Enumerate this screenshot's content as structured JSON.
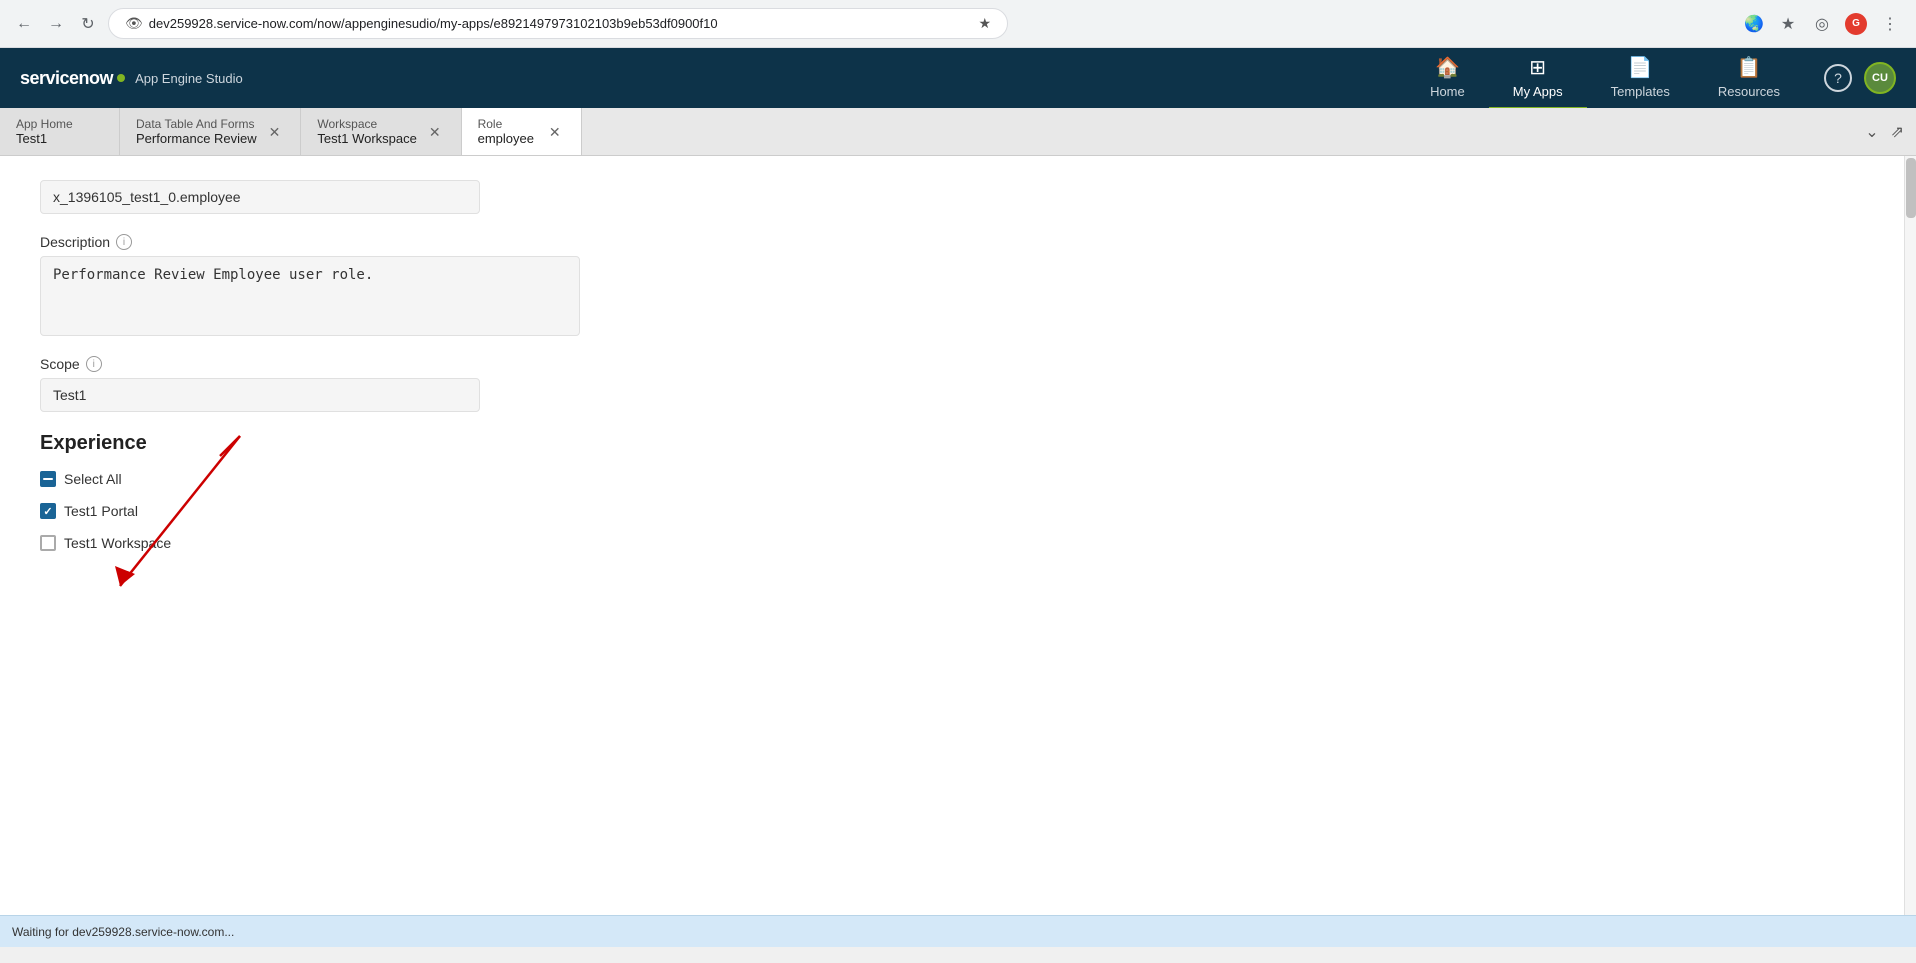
{
  "browser": {
    "url": "dev259928.service-now.com/now/appenginesudio/my-apps/e8921497973102103b9eb53df0900f10",
    "back_tooltip": "Back",
    "forward_tooltip": "Forward",
    "reload_tooltip": "Reload"
  },
  "header": {
    "logo": "servicenow",
    "logo_dot_color": "#81b522",
    "app_name": "App Engine Studio",
    "nav": [
      {
        "id": "home",
        "label": "Home",
        "icon": "🏠",
        "active": false
      },
      {
        "id": "my-apps",
        "label": "My Apps",
        "icon": "⊞",
        "active": true
      },
      {
        "id": "templates",
        "label": "Templates",
        "icon": "📄",
        "active": false
      },
      {
        "id": "resources",
        "label": "Resources",
        "icon": "📋",
        "active": false
      }
    ],
    "help_label": "?",
    "avatar_initials": "CU"
  },
  "tabs": [
    {
      "id": "app-home",
      "title": "App Home",
      "subtitle": "Test1",
      "closable": false,
      "active": false
    },
    {
      "id": "data-table",
      "title": "Data Table And Forms",
      "subtitle": "Performance Review",
      "closable": true,
      "active": false
    },
    {
      "id": "workspace",
      "title": "Workspace",
      "subtitle": "Test1 Workspace",
      "closable": true,
      "active": false
    },
    {
      "id": "role",
      "title": "Role",
      "subtitle": "employee",
      "closable": true,
      "active": true
    }
  ],
  "form": {
    "name_value": "x_1396105_test1_0.employee",
    "description_label": "Description",
    "description_value": "Performance Review Employee user role.",
    "scope_label": "Scope",
    "scope_value": "Test1",
    "experience_title": "Experience",
    "checkboxes": [
      {
        "id": "select-all",
        "label": "Select All",
        "state": "indeterminate"
      },
      {
        "id": "test1-portal",
        "label": "Test1 Portal",
        "state": "checked"
      },
      {
        "id": "test1-workspace",
        "label": "Test1 Workspace",
        "state": "unchecked"
      }
    ]
  },
  "status_bar": {
    "text": "Waiting for dev259928.service-now.com..."
  }
}
